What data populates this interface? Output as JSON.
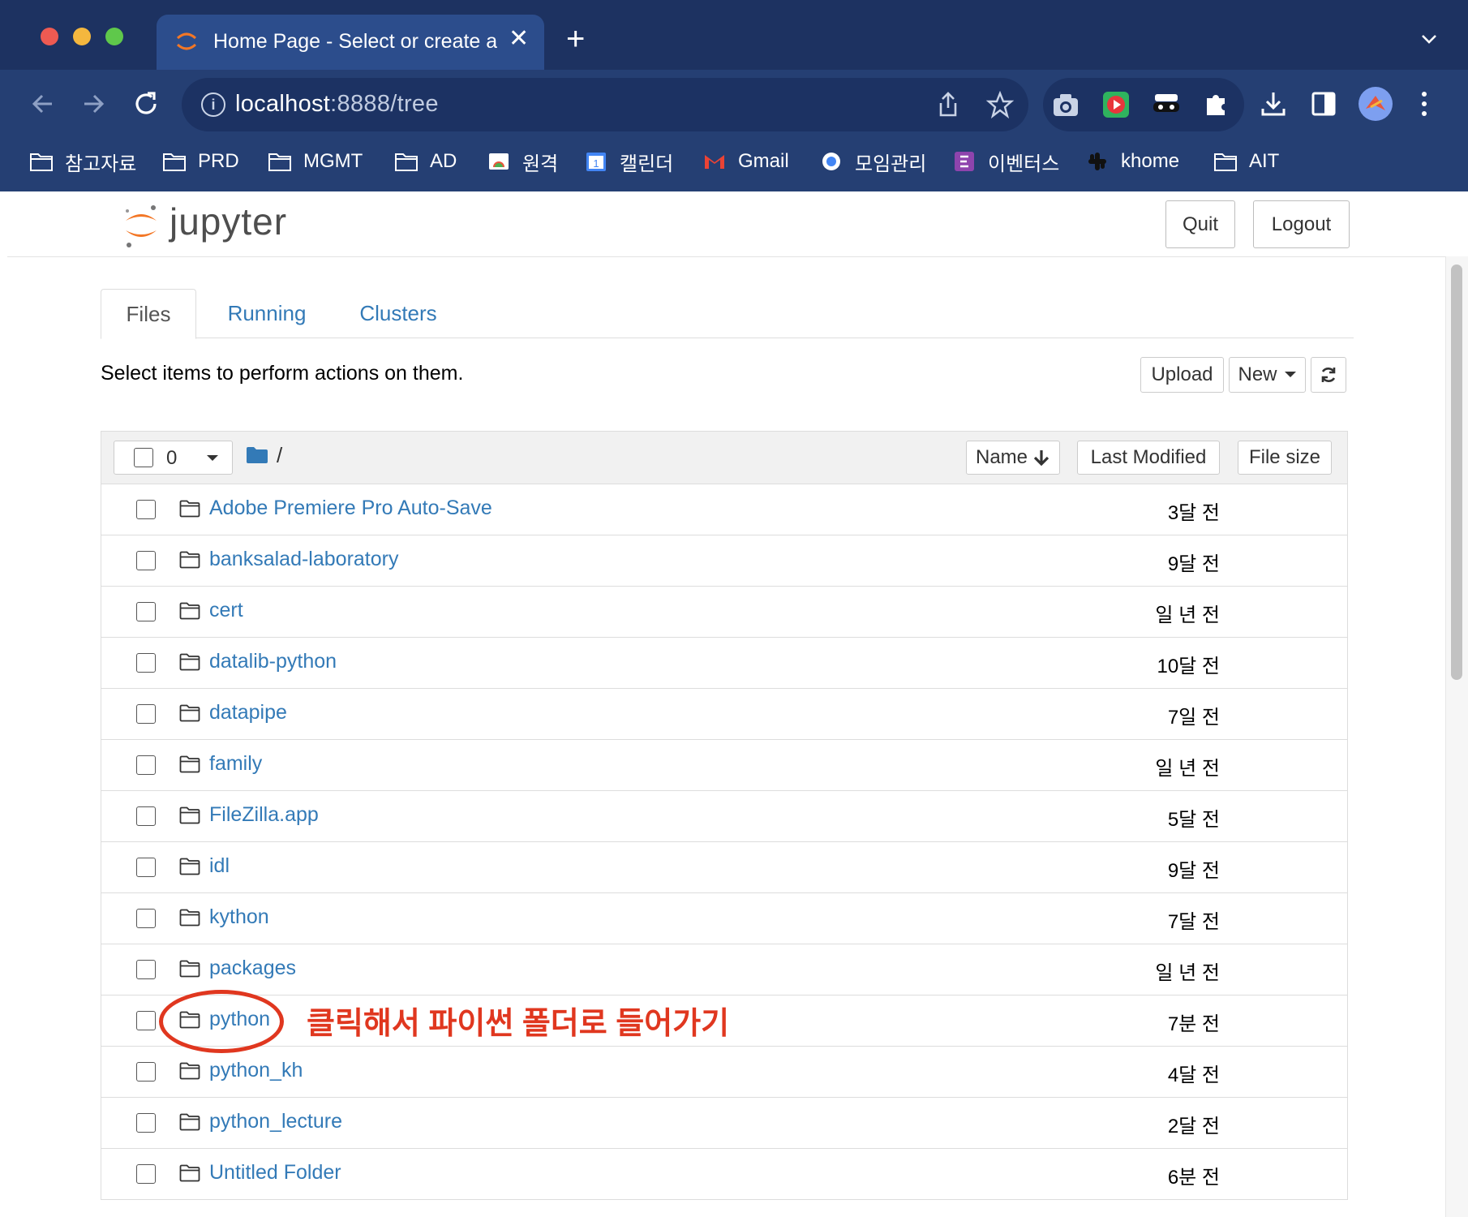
{
  "browser": {
    "tab_title": "Home Page - Select or create a notebook",
    "url_host": "localhost",
    "url_path": ":8888/tree",
    "colors": {
      "frame": "#1d3261",
      "toolbar": "#253f73",
      "close_dot": "#ee5a52",
      "min_dot": "#f4b73e",
      "max_dot": "#5fc84b"
    },
    "icons": [
      "back-arrow-icon",
      "forward-arrow-icon",
      "reload-icon",
      "info-icon",
      "share-icon",
      "star-icon",
      "camera-extension-icon",
      "video-extension-icon",
      "mask-extension-icon",
      "puzzle-extension-icon",
      "download-icon",
      "sidepanel-icon",
      "profile-avatar",
      "more-menu-icon"
    ],
    "bookmarks": [
      {
        "label": "참고자료",
        "icon": "folder-icon"
      },
      {
        "label": "PRD",
        "icon": "folder-icon"
      },
      {
        "label": "MGMT",
        "icon": "folder-icon"
      },
      {
        "label": "AD",
        "icon": "folder-icon"
      },
      {
        "label": "원격",
        "icon": "remote-icon"
      },
      {
        "label": "캘린더",
        "icon": "calendar-icon"
      },
      {
        "label": "Gmail",
        "icon": "gmail-icon"
      },
      {
        "label": "모임관리",
        "icon": "meeting-icon"
      },
      {
        "label": "이벤터스",
        "icon": "eventus-icon"
      },
      {
        "label": "khome",
        "icon": "slack-icon"
      },
      {
        "label": "AIT",
        "icon": "folder-icon"
      }
    ]
  },
  "jupyter": {
    "logo_text": "jupyter",
    "quit_label": "Quit",
    "logout_label": "Logout",
    "tabs": [
      {
        "label": "Files",
        "active": true
      },
      {
        "label": "Running",
        "active": false
      },
      {
        "label": "Clusters",
        "active": false
      }
    ],
    "hint": "Select items to perform actions on them.",
    "upload_label": "Upload",
    "new_label": "New",
    "selected_count": "0",
    "breadcrumb": "/",
    "sort_name_label": "Name",
    "sort_modified_label": "Last Modified",
    "sort_size_label": "File size",
    "link_color": "#337ab7",
    "items": [
      {
        "name": "Adobe Premiere Pro Auto-Save",
        "modified": "3달 전"
      },
      {
        "name": "banksalad-laboratory",
        "modified": "9달 전"
      },
      {
        "name": "cert",
        "modified": "일 년 전"
      },
      {
        "name": "datalib-python",
        "modified": "10달 전"
      },
      {
        "name": "datapipe",
        "modified": "7일 전"
      },
      {
        "name": "family",
        "modified": "일 년 전"
      },
      {
        "name": "FileZilla.app",
        "modified": "5달 전"
      },
      {
        "name": "idl",
        "modified": "9달 전"
      },
      {
        "name": "kython",
        "modified": "7달 전"
      },
      {
        "name": "packages",
        "modified": "일 년 전"
      },
      {
        "name": "python",
        "modified": "7분 전"
      },
      {
        "name": "python_kh",
        "modified": "4달 전"
      },
      {
        "name": "python_lecture",
        "modified": "2달 전"
      },
      {
        "name": "Untitled Folder",
        "modified": "6분 전"
      }
    ]
  },
  "annotation": {
    "text": "클릭해서 파이썬 폴더로 들어가기",
    "color": "#e0371f"
  }
}
